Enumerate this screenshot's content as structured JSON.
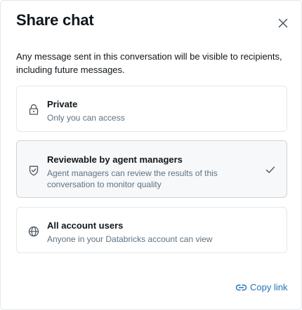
{
  "dialog": {
    "title": "Share chat",
    "close_icon": "close-icon",
    "description": "Any message sent in this conversation will be visible to recipients, including future messages."
  },
  "options": [
    {
      "icon": "lock-icon",
      "label": "Private",
      "description": "Only you can access",
      "selected": false
    },
    {
      "icon": "shield-icon",
      "label": "Reviewable by agent managers",
      "description": "Agent managers can review the results of this conversation to monitor quality",
      "selected": true
    },
    {
      "icon": "globe-icon",
      "label": "All account users",
      "description": "Anyone in your Databricks account can view",
      "selected": false
    }
  ],
  "footer": {
    "copy_link_icon": "link-icon",
    "copy_link_label": "Copy link"
  },
  "colors": {
    "text": "#11171c",
    "secondary_text": "#5f7281",
    "link": "#2272b4",
    "border": "#e4e7ea",
    "selected_bg": "#f7f8f9"
  }
}
